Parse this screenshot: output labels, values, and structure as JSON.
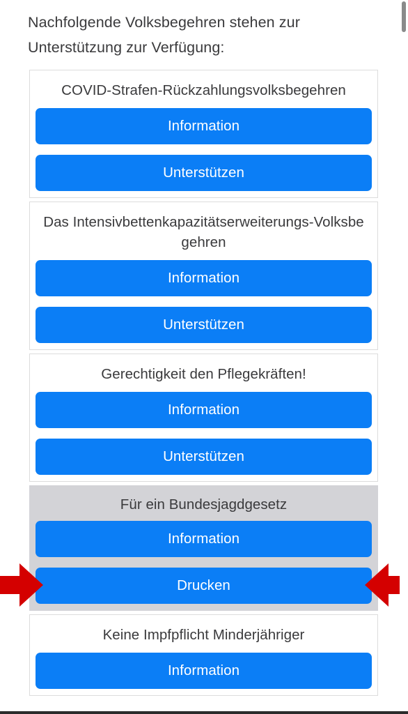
{
  "page": {
    "intro_text": "Nachfolgende Volksbegehren stehen zur Unterstützung zur Verfügung:"
  },
  "colors": {
    "button_blue": "#0b7ef6",
    "arrow_red": "#d40000",
    "highlight_gray": "#d3d3d7",
    "card_border": "#dcdcdc",
    "text_dark": "#3a3a3c",
    "scrollbar_thumb": "#8a8a8a",
    "bottom_strip": "#2b2b2b"
  },
  "annotations": {
    "left_arrow_icon": "arrow-right-pointing-red",
    "right_arrow_icon": "arrow-left-pointing-red",
    "highlighted_card_index": 3
  },
  "scrollbar": {
    "orientation": "vertical",
    "thumb_position": "top"
  },
  "cards": [
    {
      "title": "COVID-Strafen-Rückzahlungsvolksbegehren",
      "highlighted": false,
      "buttons": [
        {
          "label": "Information"
        },
        {
          "label": "Unterstützen"
        }
      ]
    },
    {
      "title": "Das Intensivbettenkapazitätserweiterungs-Volksbegehren",
      "highlighted": false,
      "buttons": [
        {
          "label": "Information"
        },
        {
          "label": "Unterstützen"
        }
      ]
    },
    {
      "title": "Gerechtigkeit den Pflegekräften!",
      "highlighted": false,
      "buttons": [
        {
          "label": "Information"
        },
        {
          "label": "Unterstützen"
        }
      ]
    },
    {
      "title": "Für ein Bundesjagdgesetz",
      "highlighted": true,
      "buttons": [
        {
          "label": "Information"
        },
        {
          "label": "Drucken"
        }
      ]
    },
    {
      "title": "Keine Impfpflicht Minderjähriger",
      "highlighted": false,
      "buttons": [
        {
          "label": "Information"
        }
      ]
    }
  ]
}
